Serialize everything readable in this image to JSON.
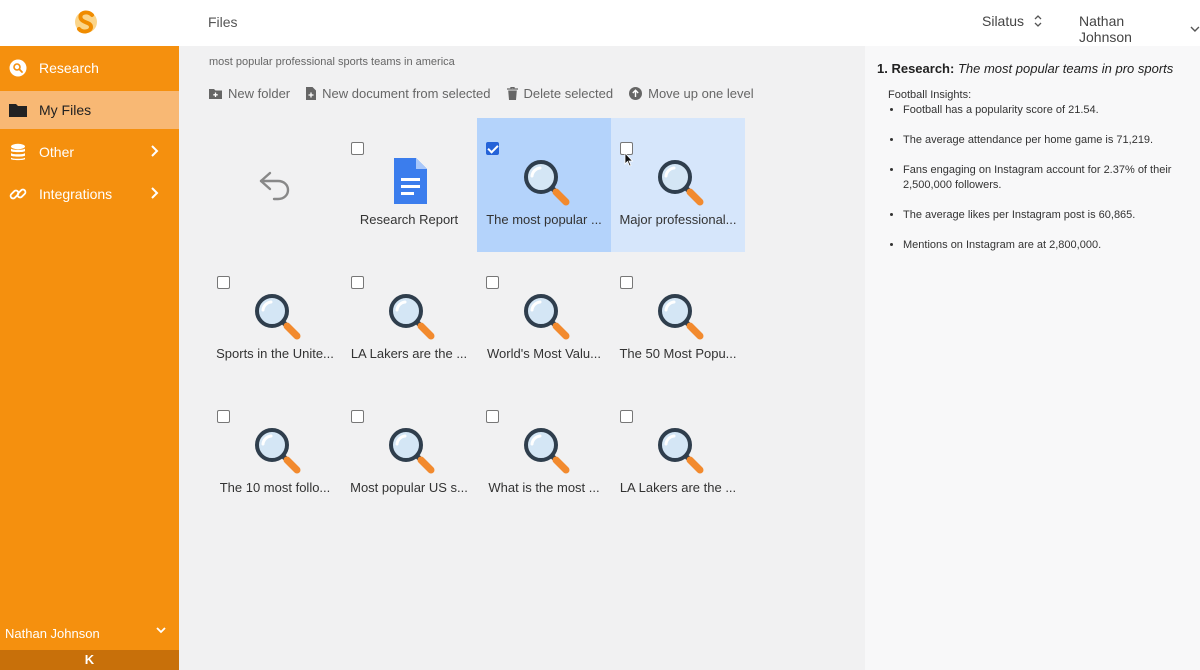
{
  "header": {
    "page_title": "Files",
    "workspace": "Silatus",
    "user": "Nathan Johnson"
  },
  "colors": {
    "sidebar": "#f5900e",
    "active_nav": "#f8b874",
    "selected_tile": "#b4d3fb",
    "hover_tile": "#d6e6fb",
    "accent": "#2563d8"
  },
  "sidebar": {
    "items": [
      {
        "label": "Research",
        "icon": "search-icon"
      },
      {
        "label": "My Files",
        "icon": "folder-icon"
      },
      {
        "label": "Other",
        "icon": "database-icon"
      },
      {
        "label": "Integrations",
        "icon": "link-icon"
      }
    ],
    "user": "Nathan Johnson",
    "collapse_label": "K"
  },
  "main": {
    "breadcrumb": "most popular professional sports teams in america",
    "toolbar": {
      "new_folder": "New folder",
      "new_document": "New document from selected",
      "delete_selected": "Delete selected",
      "move_up": "Move up one level"
    },
    "files": [
      {
        "name": "Research Report",
        "type": "document",
        "checked": false
      },
      {
        "name": "The most popular ...",
        "type": "research",
        "checked": true
      },
      {
        "name": "Major professional...",
        "type": "research",
        "checked": false
      },
      {
        "name": "Sports in the Unite...",
        "type": "research",
        "checked": false
      },
      {
        "name": "LA Lakers are the ...",
        "type": "research",
        "checked": false
      },
      {
        "name": "World's Most Valu...",
        "type": "research",
        "checked": false
      },
      {
        "name": "The 50 Most Popu...",
        "type": "research",
        "checked": false
      },
      {
        "name": "The 10 most follo...",
        "type": "research",
        "checked": false
      },
      {
        "name": "Most popular US s...",
        "type": "research",
        "checked": false
      },
      {
        "name": "What is the most ...",
        "type": "research",
        "checked": false
      },
      {
        "name": "LA Lakers are the ...",
        "type": "research",
        "checked": false
      }
    ]
  },
  "right_panel": {
    "title_prefix": "1. Research:",
    "title_text": "The most popular teams in pro sports",
    "subheading": "Football Insights:",
    "bullets": [
      "Football has a popularity score of 21.54.",
      "The average attendance per home game is 71,219.",
      "Fans engaging on Instagram account for 2.37% of their 2,500,000 followers.",
      "The average likes per Instagram post is 60,865.",
      "Mentions on Instagram are at 2,800,000."
    ]
  }
}
